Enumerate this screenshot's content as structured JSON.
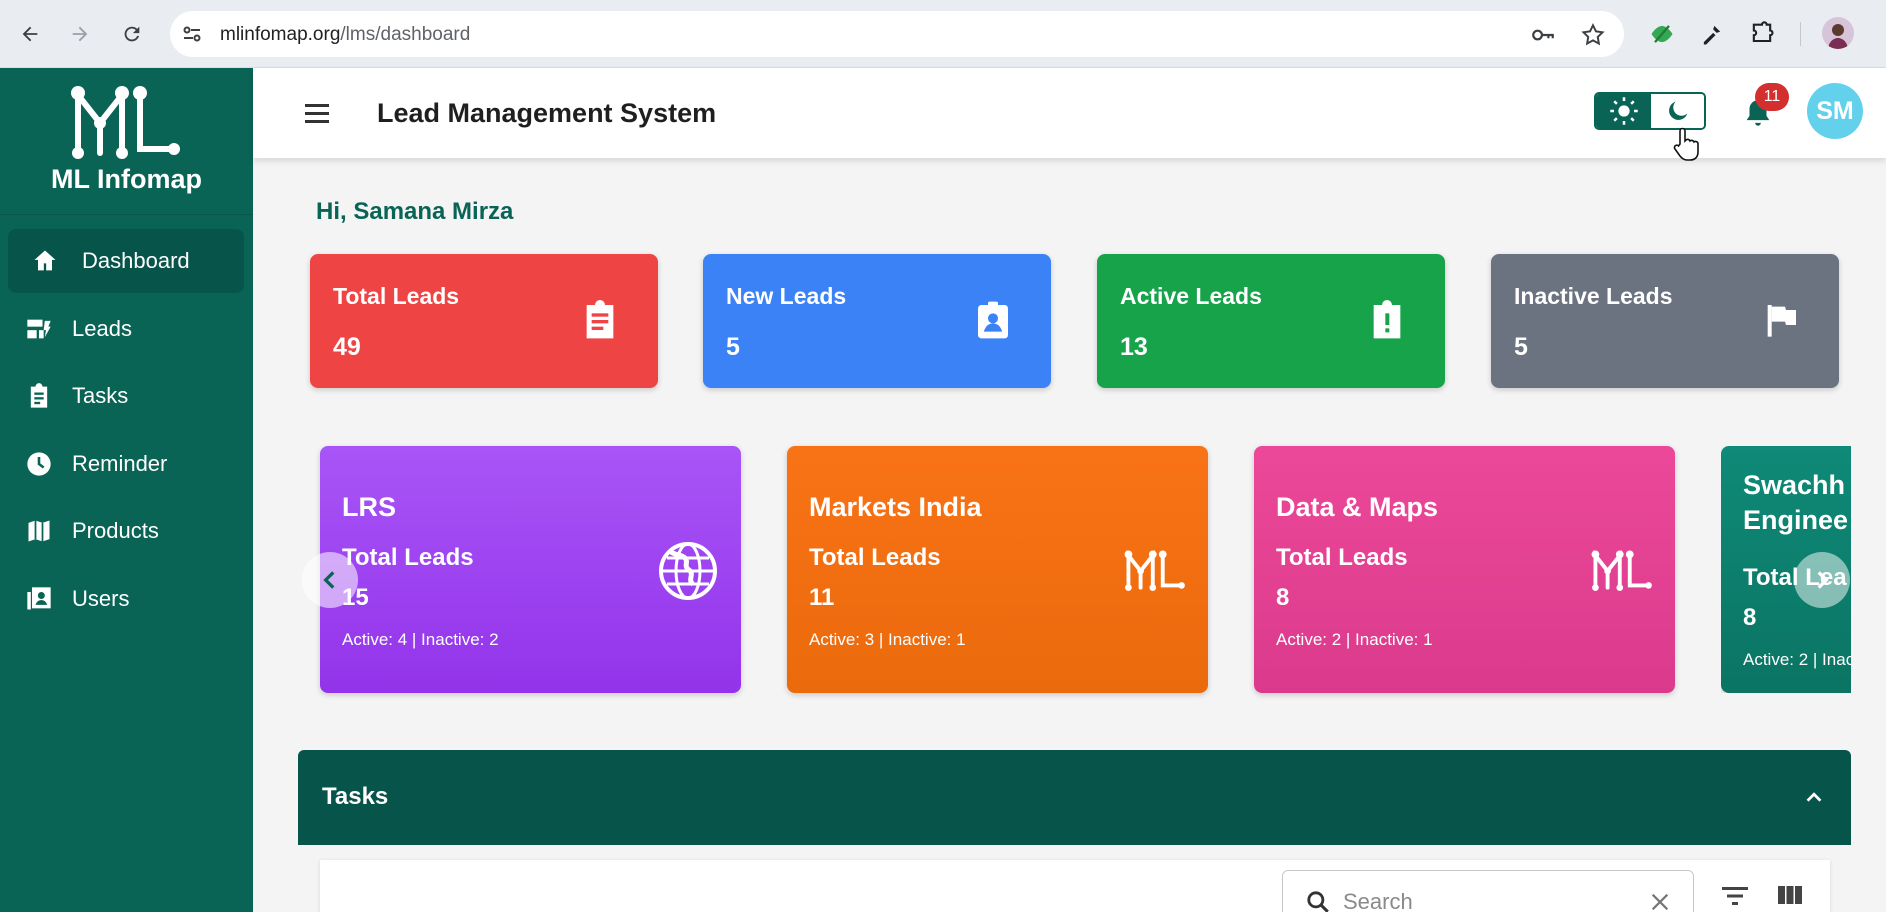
{
  "browser": {
    "url_host": "mlinfomap.org",
    "url_path": "/lms/dashboard",
    "icons": [
      "back-arrow-icon",
      "forward-arrow-icon",
      "reload-icon",
      "site-settings-icon",
      "password-key-icon",
      "bookmark-star-icon",
      "extension-icon",
      "eyedropper-icon",
      "puzzle-icon",
      "profile-avatar-icon"
    ]
  },
  "sidebar": {
    "brand": "ML Infomap",
    "items": [
      {
        "label": "Dashboard",
        "icon": "home-icon",
        "active": true
      },
      {
        "label": "Leads",
        "icon": "leads-icon"
      },
      {
        "label": "Tasks",
        "icon": "clipboard-icon"
      },
      {
        "label": "Reminder",
        "icon": "clock-icon"
      },
      {
        "label": "Products",
        "icon": "map-icon"
      },
      {
        "label": "Users",
        "icon": "contacts-icon"
      }
    ]
  },
  "header": {
    "title": "Lead Management System",
    "notifications": "11",
    "avatar_initials": "SM"
  },
  "greeting": "Hi, Samana Mirza",
  "stats": [
    {
      "label": "Total Leads",
      "value": "49",
      "color": "#ef4444",
      "icon": "clipboard-list-icon"
    },
    {
      "label": "New Leads",
      "value": "5",
      "color": "#3b82f6",
      "icon": "contact-badge-icon"
    },
    {
      "label": "Active Leads",
      "value": "13",
      "color": "#16a34a",
      "icon": "clipboard-alert-icon"
    },
    {
      "label": "Inactive Leads",
      "value": "5",
      "color": "#6b7280",
      "icon": "flag-icon"
    }
  ],
  "products": [
    {
      "name": "LRS",
      "label": "Total Leads",
      "value": "15",
      "footer": "Active: 4 | Inactive: 2",
      "color": "#a855f7",
      "icon": "globe-icon"
    },
    {
      "name": "Markets India",
      "label": "Total Leads",
      "value": "11",
      "footer": "Active: 3 | Inactive: 1",
      "color": "#f97316",
      "icon": "ml-logo-icon"
    },
    {
      "name": "Data & Maps",
      "label": "Total Leads",
      "value": "8",
      "footer": "Active: 2 | Inactive: 1",
      "color": "#ec4899",
      "icon": "ml-logo-icon"
    },
    {
      "name_line1": "Swachh",
      "name_line2": "Enginee",
      "label": "Total Lea",
      "value": "8",
      "footer": "Active: 2 | Inac",
      "color": "#0f8a78"
    }
  ],
  "tasks": {
    "title": "Tasks",
    "search_placeholder": "Search"
  }
}
